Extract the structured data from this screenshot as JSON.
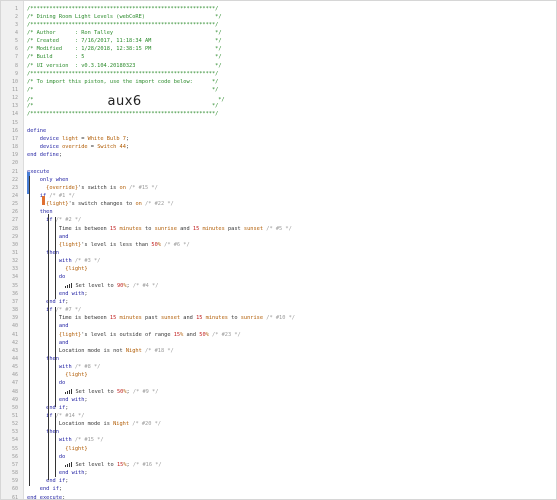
{
  "lines": [
    {
      "n": "1",
      "t": [
        [
          "c",
          "/**********************************************************/"
        ]
      ]
    },
    {
      "n": "2",
      "t": [
        [
          "c",
          "/* Dining Room Light Levels (webCoRE)                      */"
        ]
      ]
    },
    {
      "n": "3",
      "t": [
        [
          "c",
          "/**********************************************************/"
        ]
      ]
    },
    {
      "n": "4",
      "t": [
        [
          "c",
          "/* Author      : Ron Talley                                */"
        ]
      ]
    },
    {
      "n": "5",
      "t": [
        [
          "c",
          "/* Created     : 7/16/2017, 11:18:34 AM                    */"
        ]
      ]
    },
    {
      "n": "6",
      "t": [
        [
          "c",
          "/* Modified    : 1/28/2018, 12:38:15 PM                    */"
        ]
      ]
    },
    {
      "n": "7",
      "t": [
        [
          "c",
          "/* Build       : 5                                         */"
        ]
      ]
    },
    {
      "n": "8",
      "t": [
        [
          "c",
          "/* UI version  : v0.3.104.20180323                         */"
        ]
      ]
    },
    {
      "n": "9",
      "t": [
        [
          "c",
          "/**********************************************************/"
        ]
      ]
    },
    {
      "n": "10",
      "t": [
        [
          "c",
          "/* To import this piston, use the import code below:      */"
        ]
      ]
    },
    {
      "n": "11",
      "t": [
        [
          "c",
          "/*                                                        */"
        ]
      ]
    },
    {
      "n": "12",
      "t": [
        [
          "c",
          "/*"
        ],
        [
          "big",
          "                aux6"
        ],
        [
          "c",
          "                        */"
        ]
      ]
    },
    {
      "n": "13",
      "t": [
        [
          "c",
          "/*                                                        */"
        ]
      ]
    },
    {
      "n": "14",
      "t": [
        [
          "c",
          "/**********************************************************/"
        ]
      ]
    },
    {
      "n": "15",
      "t": []
    },
    {
      "n": "16",
      "t": [
        [
          "kw",
          "define"
        ]
      ]
    },
    {
      "n": "17",
      "t": [
        [
          "op",
          "    "
        ],
        [
          "kw",
          "device "
        ],
        [
          "dev",
          "light"
        ],
        [
          "op",
          " = "
        ],
        [
          "str",
          "White Bulb 7"
        ],
        [
          "op",
          ";"
        ]
      ]
    },
    {
      "n": "18",
      "t": [
        [
          "op",
          "    "
        ],
        [
          "kw",
          "device "
        ],
        [
          "dev",
          "override"
        ],
        [
          "op",
          " = "
        ],
        [
          "str",
          "Switch 44"
        ],
        [
          "op",
          ";"
        ]
      ]
    },
    {
      "n": "19",
      "t": [
        [
          "kw",
          "end define"
        ],
        [
          "op",
          ";"
        ]
      ]
    },
    {
      "n": "20",
      "t": []
    },
    {
      "n": "21",
      "t": [
        [
          "kw",
          "execute"
        ]
      ]
    },
    {
      "n": "22",
      "t": [
        [
          "op",
          "    "
        ],
        [
          "kw",
          "only when"
        ]
      ]
    },
    {
      "n": "23",
      "t": [
        [
          "op",
          "      "
        ],
        [
          "dev",
          "{override}"
        ],
        [
          "op",
          "'s switch is "
        ],
        [
          "str",
          "on"
        ],
        [
          "hint",
          " /* #15 */"
        ]
      ]
    },
    {
      "n": "24",
      "t": [
        [
          "op",
          "    "
        ],
        [
          "kw",
          "if"
        ],
        [
          "hint",
          " /* #1 */"
        ]
      ]
    },
    {
      "n": "25",
      "t": [
        [
          "op",
          "      "
        ],
        [
          "dev",
          "{light}"
        ],
        [
          "op",
          "'s switch changes to "
        ],
        [
          "str",
          "on"
        ],
        [
          "hint",
          " /* #22 */"
        ]
      ]
    },
    {
      "n": "26",
      "t": [
        [
          "op",
          "    "
        ],
        [
          "kw",
          "then"
        ]
      ]
    },
    {
      "n": "27",
      "t": [
        [
          "op",
          "      "
        ],
        [
          "kw",
          "if"
        ],
        [
          "hint",
          " /* #2 */"
        ]
      ]
    },
    {
      "n": "28",
      "t": [
        [
          "op",
          "          Time is between "
        ],
        [
          "num",
          "15"
        ],
        [
          "str",
          " minutes"
        ],
        [
          "op",
          " to "
        ],
        [
          "str",
          "sunrise"
        ],
        [
          "op",
          " and "
        ],
        [
          "num",
          "15"
        ],
        [
          "str",
          " minutes"
        ],
        [
          "op",
          " past "
        ],
        [
          "str",
          "sunset"
        ],
        [
          "hint",
          " /* #5 */"
        ]
      ]
    },
    {
      "n": "29",
      "t": [
        [
          "op",
          "          "
        ],
        [
          "kw",
          "and"
        ]
      ]
    },
    {
      "n": "30",
      "t": [
        [
          "op",
          "          "
        ],
        [
          "dev",
          "{light}"
        ],
        [
          "op",
          "'s level is less than "
        ],
        [
          "num",
          "50"
        ],
        [
          "str",
          "%"
        ],
        [
          "hint",
          " /* #6 */"
        ]
      ]
    },
    {
      "n": "31",
      "t": [
        [
          "op",
          "      "
        ],
        [
          "kw",
          "then"
        ]
      ]
    },
    {
      "n": "32",
      "t": [
        [
          "op",
          "          "
        ],
        [
          "kw",
          "with"
        ],
        [
          "hint",
          " /* #3 */"
        ]
      ]
    },
    {
      "n": "33",
      "t": [
        [
          "op",
          "            "
        ],
        [
          "dev",
          "{light}"
        ]
      ]
    },
    {
      "n": "34",
      "t": [
        [
          "op",
          "          "
        ],
        [
          "kw",
          "do"
        ]
      ]
    },
    {
      "n": "35",
      "t": [
        [
          "op",
          "            "
        ],
        [
          "icon",
          ""
        ],
        [
          "op",
          " Set level to "
        ],
        [
          "num",
          "90"
        ],
        [
          "str",
          "%"
        ],
        [
          "op",
          ";"
        ],
        [
          "hint",
          " /* #4 */"
        ]
      ]
    },
    {
      "n": "36",
      "t": [
        [
          "op",
          "          "
        ],
        [
          "kw",
          "end with"
        ],
        [
          "op",
          ";"
        ]
      ]
    },
    {
      "n": "37",
      "t": [
        [
          "op",
          "      "
        ],
        [
          "kw",
          "end if"
        ],
        [
          "op",
          ";"
        ]
      ]
    },
    {
      "n": "38",
      "t": [
        [
          "op",
          "      "
        ],
        [
          "kw",
          "if"
        ],
        [
          "hint",
          " /* #7 */"
        ]
      ]
    },
    {
      "n": "39",
      "t": [
        [
          "op",
          "          Time is between "
        ],
        [
          "num",
          "15"
        ],
        [
          "str",
          " minutes"
        ],
        [
          "op",
          " past "
        ],
        [
          "str",
          "sunset"
        ],
        [
          "op",
          " and "
        ],
        [
          "num",
          "15"
        ],
        [
          "str",
          " minutes"
        ],
        [
          "op",
          " to "
        ],
        [
          "str",
          "sunrise"
        ],
        [
          "hint",
          " /* #10 */"
        ]
      ]
    },
    {
      "n": "40",
      "t": [
        [
          "op",
          "          "
        ],
        [
          "kw",
          "and"
        ]
      ]
    },
    {
      "n": "41",
      "t": [
        [
          "op",
          "          "
        ],
        [
          "dev",
          "{light}"
        ],
        [
          "op",
          "'s level is outside of range "
        ],
        [
          "num",
          "15"
        ],
        [
          "str",
          "%"
        ],
        [
          "op",
          " and "
        ],
        [
          "num",
          "50"
        ],
        [
          "str",
          "%"
        ],
        [
          "hint",
          " /* #23 */"
        ]
      ]
    },
    {
      "n": "42",
      "t": [
        [
          "op",
          "          "
        ],
        [
          "kw",
          "and"
        ]
      ]
    },
    {
      "n": "43",
      "t": [
        [
          "op",
          "          Location mode is not "
        ],
        [
          "str",
          "Night"
        ],
        [
          "hint",
          " /* #18 */"
        ]
      ]
    },
    {
      "n": "44",
      "t": [
        [
          "op",
          "      "
        ],
        [
          "kw",
          "then"
        ]
      ]
    },
    {
      "n": "45",
      "t": [
        [
          "op",
          "          "
        ],
        [
          "kw",
          "with"
        ],
        [
          "hint",
          " /* #8 */"
        ]
      ]
    },
    {
      "n": "46",
      "t": [
        [
          "op",
          "            "
        ],
        [
          "dev",
          "{light}"
        ]
      ]
    },
    {
      "n": "47",
      "t": [
        [
          "op",
          "          "
        ],
        [
          "kw",
          "do"
        ]
      ]
    },
    {
      "n": "48",
      "t": [
        [
          "op",
          "            "
        ],
        [
          "icon",
          ""
        ],
        [
          "op",
          " Set level to "
        ],
        [
          "num",
          "50"
        ],
        [
          "str",
          "%"
        ],
        [
          "op",
          ";"
        ],
        [
          "hint",
          " /* #9 */"
        ]
      ]
    },
    {
      "n": "49",
      "t": [
        [
          "op",
          "          "
        ],
        [
          "kw",
          "end with"
        ],
        [
          "op",
          ";"
        ]
      ]
    },
    {
      "n": "50",
      "t": [
        [
          "op",
          "      "
        ],
        [
          "kw",
          "end if"
        ],
        [
          "op",
          ";"
        ]
      ]
    },
    {
      "n": "51",
      "t": [
        [
          "op",
          "      "
        ],
        [
          "kw",
          "if"
        ],
        [
          "hint",
          " /* #14 */"
        ]
      ]
    },
    {
      "n": "52",
      "t": [
        [
          "op",
          "          Location mode is "
        ],
        [
          "str",
          "Night"
        ],
        [
          "hint",
          " /* #20 */"
        ]
      ]
    },
    {
      "n": "53",
      "t": [
        [
          "op",
          "      "
        ],
        [
          "kw",
          "then"
        ]
      ]
    },
    {
      "n": "54",
      "t": [
        [
          "op",
          "          "
        ],
        [
          "kw",
          "with"
        ],
        [
          "hint",
          " /* #15 */"
        ]
      ]
    },
    {
      "n": "55",
      "t": [
        [
          "op",
          "            "
        ],
        [
          "dev",
          "{light}"
        ]
      ]
    },
    {
      "n": "56",
      "t": [
        [
          "op",
          "          "
        ],
        [
          "kw",
          "do"
        ]
      ]
    },
    {
      "n": "57",
      "t": [
        [
          "op",
          "            "
        ],
        [
          "icon",
          ""
        ],
        [
          "op",
          " Set level to "
        ],
        [
          "num",
          "15"
        ],
        [
          "str",
          "%"
        ],
        [
          "op",
          ";"
        ],
        [
          "hint",
          " /* #16 */"
        ]
      ]
    },
    {
      "n": "58",
      "t": [
        [
          "op",
          "          "
        ],
        [
          "kw",
          "end with"
        ],
        [
          "op",
          ";"
        ]
      ]
    },
    {
      "n": "59",
      "t": [
        [
          "op",
          "      "
        ],
        [
          "kw",
          "end if"
        ],
        [
          "op",
          ";"
        ]
      ]
    },
    {
      "n": "60",
      "t": [
        [
          "op",
          "    "
        ],
        [
          "kw",
          "end if"
        ],
        [
          "op",
          ";"
        ]
      ]
    },
    {
      "n": "61",
      "t": [
        [
          "kw",
          "end execute"
        ],
        [
          "op",
          ";"
        ]
      ]
    }
  ],
  "colors": {
    "accent": "#4a7fd6",
    "warning": "#e07030",
    "keyword": "#1a1aa0",
    "comment": "#2a8a2a",
    "value": "#b05a00",
    "number": "#c02020"
  }
}
